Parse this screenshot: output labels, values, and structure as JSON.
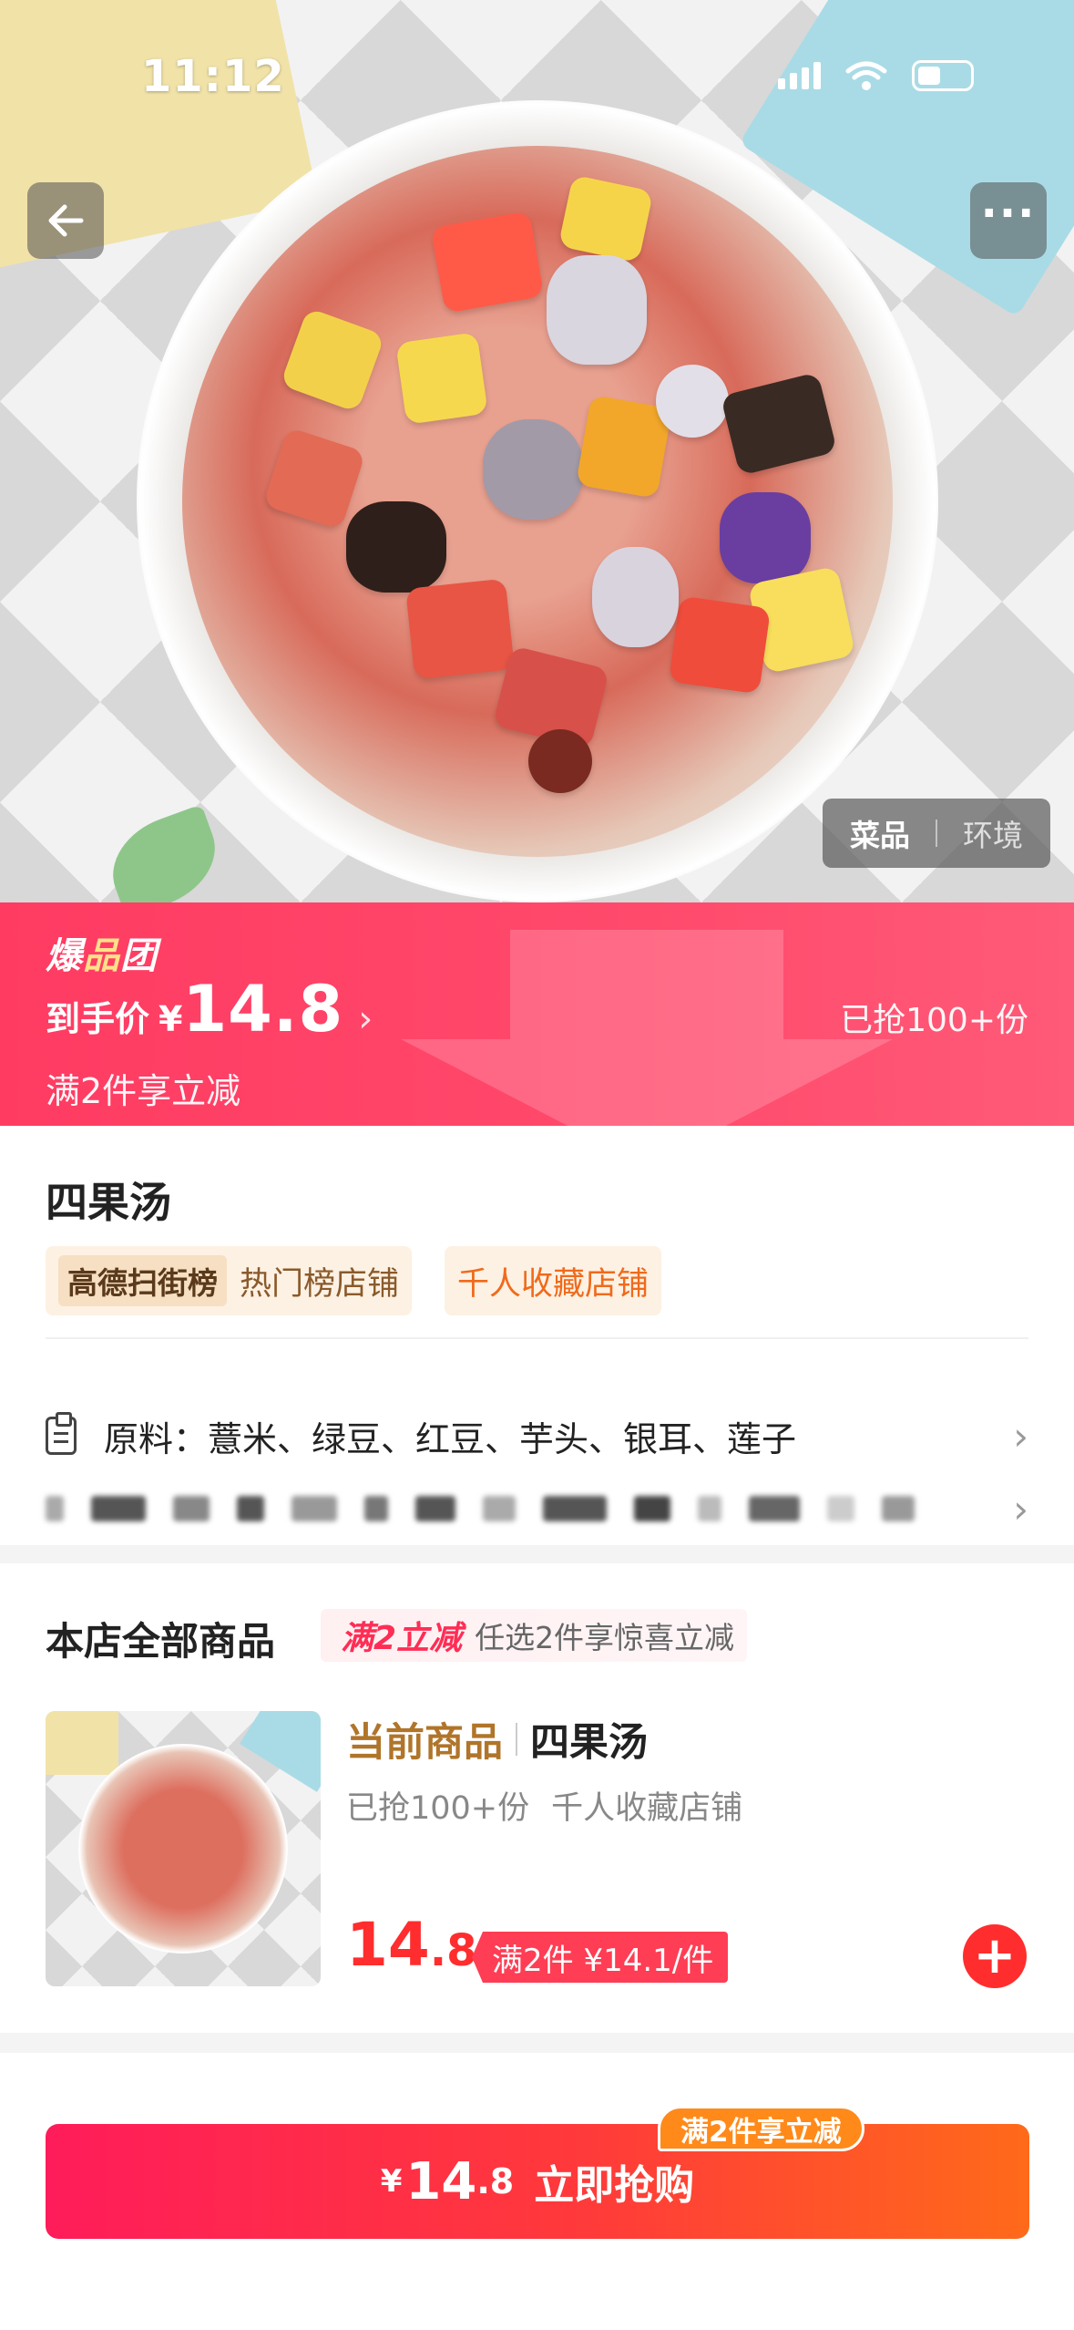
{
  "status_bar": {
    "time": "11:12"
  },
  "image_tabs": {
    "dish": "菜品",
    "environment": "环境"
  },
  "deal": {
    "brand_prefix": "爆",
    "brand_highlight": "品",
    "brand_suffix": "团",
    "price_label": "到手价",
    "currency": "¥",
    "price": "14.8",
    "chevron": "›",
    "subtitle": "满2件享立减",
    "sold": "已抢100+份"
  },
  "product": {
    "name": "四果汤",
    "rank_logo": "高德扫街榜",
    "rank_text": "热门榜店铺",
    "fav_tag": "千人收藏店铺",
    "ingredients": "原料：薏米、绿豆、红豆、芋头、银耳、莲子"
  },
  "store": {
    "title": "本店全部商品",
    "promo_main": "满2立减",
    "promo_desc": "任选2件享惊喜立减",
    "item": {
      "tag": "当前商品",
      "name": "四果汤",
      "sold": "已抢100+份",
      "fav": "千人收藏店铺",
      "price_int": "14",
      "price_dec": ".8",
      "multi": "满2件 ¥14.1/件"
    }
  },
  "bottom": {
    "currency": "¥",
    "price_int": "14",
    "price_dec": ".8",
    "label": "立即抢购",
    "bubble": "满2件享立减"
  },
  "colors": {
    "accent": "#ff3b62",
    "price_red": "#ff2d2d",
    "gold": "#b0752a"
  }
}
